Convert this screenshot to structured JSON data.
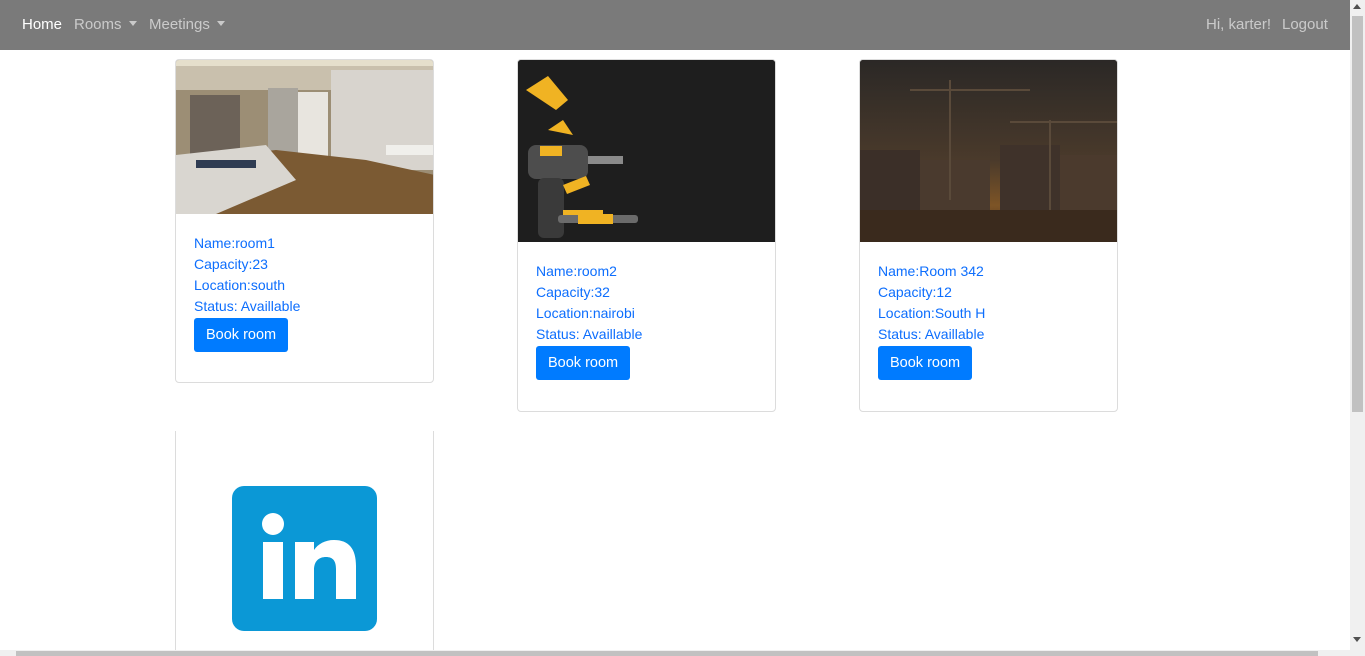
{
  "navbar": {
    "home": "Home",
    "rooms": "Rooms",
    "meetings": "Meetings",
    "greeting": "Hi, karter!",
    "logout": "Logout"
  },
  "rooms": [
    {
      "name": "Name:room1",
      "capacity": "Capacity:23",
      "location": "Location:south",
      "status": "Status: Availlable",
      "button": "Book room"
    },
    {
      "name": "Name:room2",
      "capacity": "Capacity:32",
      "location": "Location:nairobi",
      "status": "Status: Availlable",
      "button": "Book room"
    },
    {
      "name": "Name:Room 342",
      "capacity": "Capacity:12",
      "location": "Location:South H",
      "status": "Status: Availlable",
      "button": "Book room"
    }
  ],
  "colors": {
    "navbar_bg": "#7a7a7a",
    "link": "#0d6efd",
    "button": "#007bff",
    "linkedin": "#0b98d6"
  }
}
